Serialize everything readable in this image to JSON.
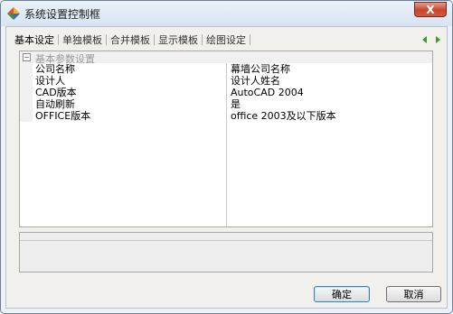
{
  "window": {
    "title": "系统设置控制框",
    "close_label": "X"
  },
  "tabs": [
    {
      "label": "基本设定",
      "active": true
    },
    {
      "label": "单独模板",
      "active": false
    },
    {
      "label": "合并模板",
      "active": false
    },
    {
      "label": "显示模板",
      "active": false
    },
    {
      "label": "绘图设定",
      "active": false
    }
  ],
  "property_grid": {
    "group_label": "基本参数设置",
    "rows": [
      {
        "name": "公司名称",
        "value": "幕墙公司名称"
      },
      {
        "name": "设计人",
        "value": "设计人姓名"
      },
      {
        "name": "CAD版本",
        "value": "AutoCAD 2004"
      },
      {
        "name": "自动刷新",
        "value": "是"
      },
      {
        "name": "OFFICE版本",
        "value": "office 2003及以下版本"
      }
    ]
  },
  "buttons": {
    "ok": "确定",
    "cancel": "取消"
  },
  "colors": {
    "nav_arrow": "#3a9c2b",
    "close": "#c7452f"
  },
  "icons": {
    "app": "diamond-app-icon",
    "nav_left": "triangle-left-icon",
    "nav_right": "triangle-right-icon"
  }
}
